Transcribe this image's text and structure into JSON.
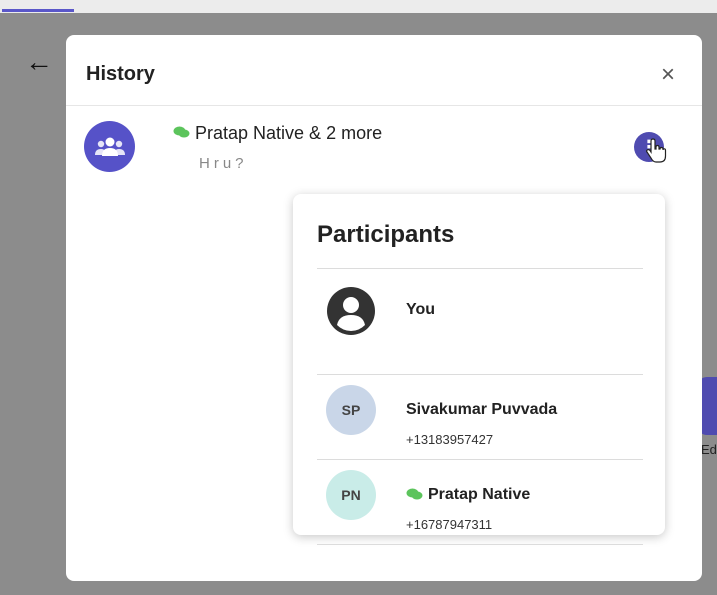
{
  "dialog": {
    "title": "History",
    "close_label": "×"
  },
  "conversation": {
    "title": "Pratap Native & 2 more",
    "preview": "Hru?",
    "channel_icon": "whatsapp-icon",
    "avatar_icon": "group-icon",
    "more_label": "⋮"
  },
  "participants": {
    "title": "Participants",
    "items": [
      {
        "name": "You",
        "phone": "",
        "initials": "",
        "avatar_icon": "user-circle-icon"
      },
      {
        "name": "Sivakumar Puvvada",
        "phone": "+13183957427",
        "initials": "SP"
      },
      {
        "name": "Pratap Native",
        "phone": "+16787947311",
        "initials": "PN",
        "channel_icon": "whatsapp-icon"
      }
    ]
  },
  "background": {
    "back_label": "←",
    "edge_label": "Ed"
  },
  "colors": {
    "accent": "#4f4bb0",
    "whatsapp_green": "#5cc45c",
    "sp_avatar_bg": "#c9d6e8",
    "pn_avatar_bg": "#c9ece8"
  }
}
